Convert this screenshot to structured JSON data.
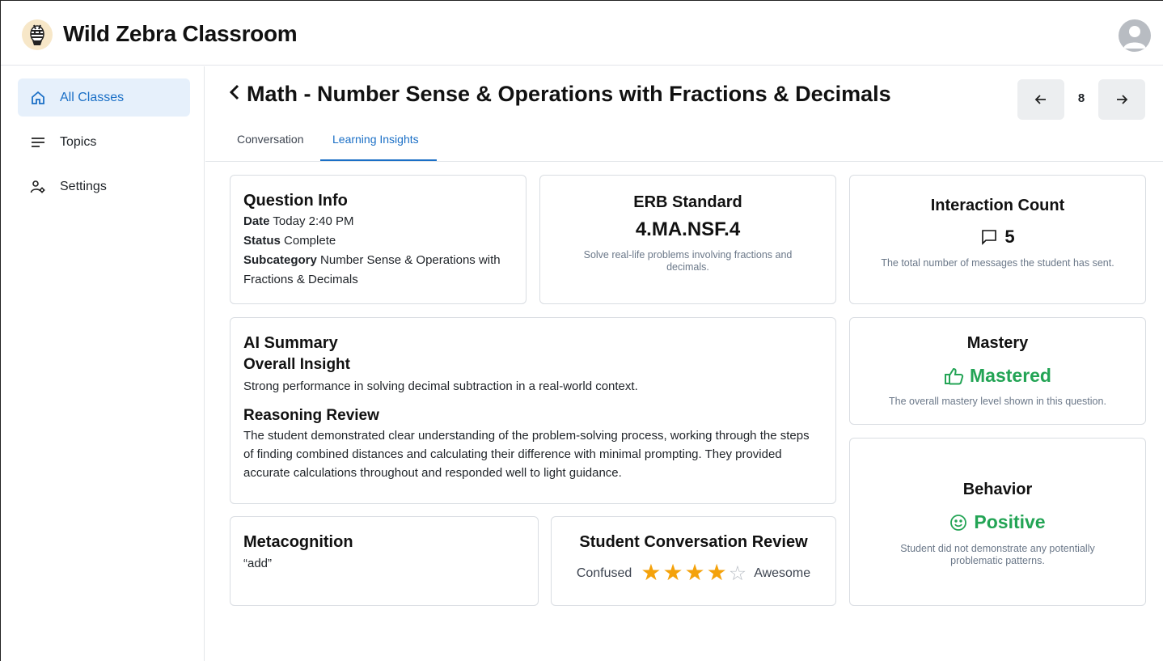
{
  "app": {
    "title": "Wild Zebra Classroom"
  },
  "sidebar": {
    "items": [
      {
        "label": "All Classes",
        "icon": "home-icon",
        "active": true
      },
      {
        "label": "Topics",
        "icon": "menu-lines-icon",
        "active": false
      },
      {
        "label": "Settings",
        "icon": "user-settings-icon",
        "active": false
      }
    ]
  },
  "page": {
    "title": "Math - Number Sense & Operations with Fractions & Decimals",
    "page_number": "8",
    "tabs": [
      {
        "label": "Conversation",
        "active": false
      },
      {
        "label": "Learning Insights",
        "active": true
      }
    ]
  },
  "question_info": {
    "heading": "Question Info",
    "date_label": "Date",
    "date_value": "Today 2:40 PM",
    "status_label": "Status",
    "status_value": "Complete",
    "subcategory_label": "Subcategory",
    "subcategory_value": "Number Sense & Operations with Fractions & Decimals"
  },
  "erb": {
    "heading": "ERB Standard",
    "code": "4.MA.NSF.4",
    "description": "Solve real-life problems involving fractions and decimals."
  },
  "interaction": {
    "heading": "Interaction Count",
    "count": "5",
    "description": "The total number of messages the student has sent."
  },
  "ai_summary": {
    "heading": "AI Summary",
    "overall_heading": "Overall Insight",
    "overall_text": "Strong performance in solving decimal subtraction in a real-world context.",
    "reasoning_heading": "Reasoning Review",
    "reasoning_text": "The student demonstrated clear understanding of the problem-solving process, working through the steps of finding combined distances and calculating their difference with minimal prompting. They provided accurate calculations throughout and responded well to light guidance."
  },
  "mastery": {
    "heading": "Mastery",
    "value": "Mastered",
    "description": "The overall mastery level shown in this question.",
    "color": "#23a455"
  },
  "behavior": {
    "heading": "Behavior",
    "value": "Positive",
    "description": "Student did not demonstrate any potentially problematic patterns.",
    "color": "#23a455"
  },
  "metacognition": {
    "heading": "Metacognition",
    "text": "“add”"
  },
  "conversation_review": {
    "heading": "Student Conversation Review",
    "low_label": "Confused",
    "high_label": "Awesome",
    "rating": 4,
    "max_rating": 5
  },
  "colors": {
    "accent": "#1a6fc6",
    "star": "#f4a20b",
    "positive": "#23a455"
  }
}
